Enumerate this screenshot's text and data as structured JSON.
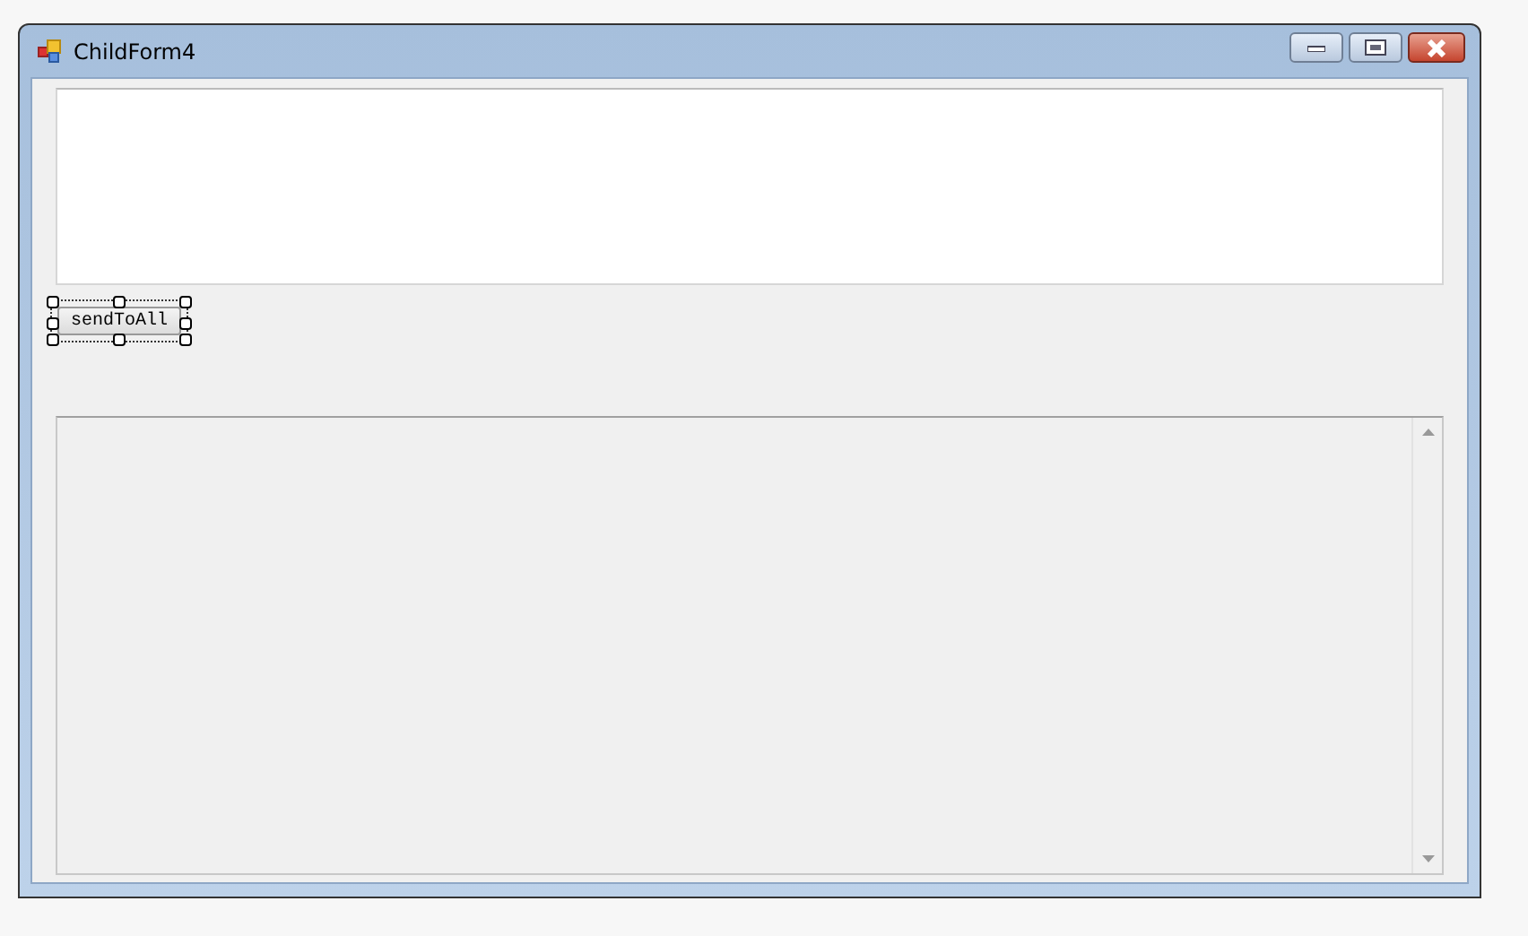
{
  "window": {
    "title": "ChildForm4"
  },
  "controls": [
    {
      "kind": "textbox"
    },
    {
      "kind": "button",
      "label": "sendToAll",
      "selected": true
    },
    {
      "kind": "log"
    }
  ]
}
